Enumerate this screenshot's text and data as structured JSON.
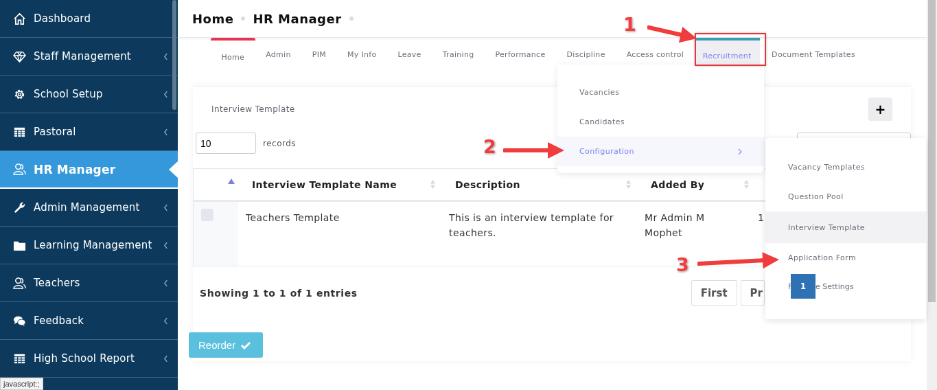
{
  "sidebar": {
    "items": [
      {
        "label": "Dashboard",
        "selected": false,
        "expandable": false
      },
      {
        "label": "Staff Management",
        "selected": false,
        "expandable": true
      },
      {
        "label": "School Setup",
        "selected": false,
        "expandable": true
      },
      {
        "label": "Pastoral",
        "selected": false,
        "expandable": true
      },
      {
        "label": "HR Manager",
        "selected": true,
        "expandable": false
      },
      {
        "label": "Admin Management",
        "selected": false,
        "expandable": true
      },
      {
        "label": "Learning Management",
        "selected": false,
        "expandable": true
      },
      {
        "label": "Teachers",
        "selected": false,
        "expandable": true
      },
      {
        "label": "Feedback",
        "selected": false,
        "expandable": true
      },
      {
        "label": "High School Report",
        "selected": false,
        "expandable": true
      }
    ]
  },
  "breadcrumb": [
    "Home",
    "HR Manager"
  ],
  "tabs": [
    {
      "label": "Home",
      "selected": true,
      "open": false
    },
    {
      "label": "Admin",
      "selected": false,
      "open": false
    },
    {
      "label": "PIM",
      "selected": false,
      "open": false
    },
    {
      "label": "My Info",
      "selected": false,
      "open": false
    },
    {
      "label": "Leave",
      "selected": false,
      "open": false
    },
    {
      "label": "Training",
      "selected": false,
      "open": false
    },
    {
      "label": "Performance",
      "selected": false,
      "open": false
    },
    {
      "label": "Discipline",
      "selected": false,
      "open": false
    },
    {
      "label": "Access control",
      "selected": false,
      "open": false
    },
    {
      "label": "Recruitment",
      "selected": false,
      "open": true
    },
    {
      "label": "Document Templates",
      "selected": false,
      "open": false
    }
  ],
  "card": {
    "title": "Interview Template",
    "add_button": "+",
    "page_length": "10",
    "records_label": "records"
  },
  "table": {
    "columns": [
      {
        "label": "Interview Template Name"
      },
      {
        "label": "Description"
      },
      {
        "label": "Added By"
      }
    ],
    "rows": [
      {
        "checked": false,
        "cells": [
          "Teachers Template",
          "This is an interview template for teachers.",
          "Mr Admin M Mophet",
          "1"
        ]
      }
    ]
  },
  "footer": {
    "info": "Showing 1 to 1 of 1 entries",
    "pages": [
      "First",
      "Pr"
    ],
    "current_page": "1"
  },
  "reorder_button": "Reorder",
  "menu": {
    "items": [
      {
        "label": "Vacancies",
        "selected": false,
        "submenu": false
      },
      {
        "label": "Candidates",
        "selected": false,
        "submenu": false
      },
      {
        "label": "Configuration",
        "selected": true,
        "submenu": true
      }
    ]
  },
  "submenu": {
    "items": [
      {
        "label": "Vacancy Templates",
        "selected": false
      },
      {
        "label": "Question Pool",
        "selected": false
      },
      {
        "label": "Interview Template",
        "selected": true
      },
      {
        "label": "Application Form",
        "selected": false
      }
    ],
    "last_item_start": "F",
    "last_item_end": "e Settings"
  },
  "annotations": [
    "1",
    "2",
    "3"
  ],
  "status_tooltip": "javascript:;"
}
